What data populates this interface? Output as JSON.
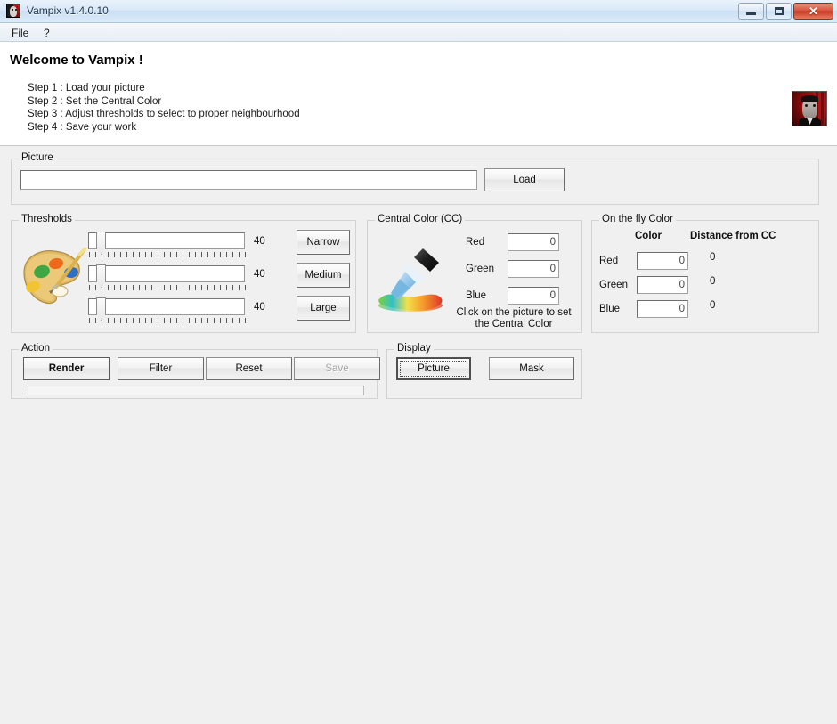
{
  "window": {
    "title": "Vampix v1.4.0.10",
    "app_icon": "vampire-icon",
    "caption": {
      "minimize": "minimize-icon",
      "maximize": "maximize-icon",
      "close": "✕"
    }
  },
  "menubar": {
    "items": [
      {
        "label": "File",
        "name": "menu-file"
      },
      {
        "label": "?",
        "name": "menu-help"
      }
    ]
  },
  "welcome": {
    "title": "Welcome to Vampix !",
    "steps": [
      "Step 1 : Load your picture",
      "Step 2 : Set the Central Color",
      "Step 3 : Adjust thresholds to select to proper neighbourhood",
      "Step 4 : Save your work"
    ],
    "logo_alt": "vampire-logo"
  },
  "picture": {
    "group_label": "Picture",
    "path_value": "",
    "path_placeholder": "",
    "load_label": "Load"
  },
  "thresholds": {
    "group_label": "Thresholds",
    "icon": "palette-icon",
    "sliders": [
      {
        "value": "40",
        "position_pct": 9,
        "min": 0,
        "max": 255
      },
      {
        "value": "40",
        "position_pct": 9,
        "min": 0,
        "max": 255
      },
      {
        "value": "40",
        "position_pct": 9,
        "min": 0,
        "max": 255
      }
    ],
    "presets": [
      {
        "label": "Narrow",
        "name": "narrow-button"
      },
      {
        "label": "Medium",
        "name": "medium-button"
      },
      {
        "label": "Large",
        "name": "large-button"
      }
    ]
  },
  "central_color": {
    "group_label": "Central Color (CC)",
    "icon": "eyedropper-icon",
    "channels": [
      {
        "label": "Red",
        "value": "0"
      },
      {
        "label": "Green",
        "value": "0"
      },
      {
        "label": "Blue",
        "value": "0"
      }
    ],
    "hint_line1": "Click on the picture to set",
    "hint_line2": "the Central Color"
  },
  "on_the_fly": {
    "group_label": "On the fly Color",
    "header_color": "Color",
    "header_distance": "Distance from CC",
    "rows": [
      {
        "label": "Red",
        "color_value": "0",
        "distance": "0"
      },
      {
        "label": "Green",
        "color_value": "0",
        "distance": "0"
      },
      {
        "label": "Blue",
        "color_value": "0",
        "distance": "0"
      }
    ]
  },
  "action": {
    "group_label": "Action",
    "buttons": [
      {
        "label": "Render",
        "name": "render-button",
        "state": "default"
      },
      {
        "label": "Filter",
        "name": "filter-button",
        "state": "normal"
      },
      {
        "label": "Reset",
        "name": "reset-button",
        "state": "normal"
      },
      {
        "label": "Save",
        "name": "save-button",
        "state": "disabled"
      }
    ],
    "progress_value": 0
  },
  "display": {
    "group_label": "Display",
    "buttons": [
      {
        "label": "Picture",
        "name": "picture-button",
        "state": "focused"
      },
      {
        "label": "Mask",
        "name": "mask-button",
        "state": "normal"
      }
    ]
  }
}
